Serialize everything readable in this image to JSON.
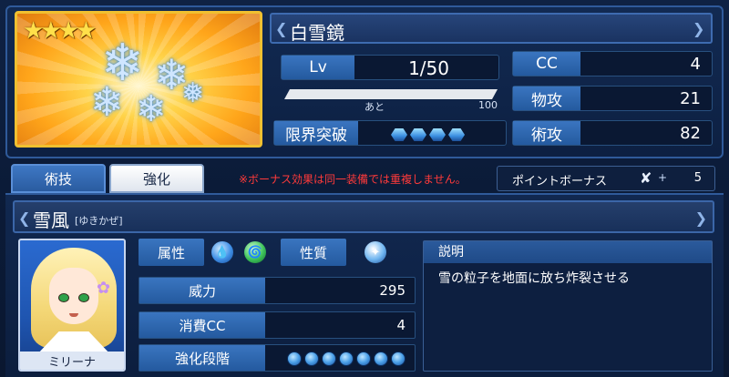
{
  "equipment": {
    "name": "白雪鏡",
    "rarity_stars": "★★★★",
    "level_label": "Lv",
    "level_value": "1/50",
    "xp_remaining_label": "あと",
    "xp_max": "100",
    "limit_break_label": "限界突破",
    "limit_break_level": 0,
    "stats": [
      {
        "label": "CC",
        "value": "4"
      },
      {
        "label": "物攻",
        "value": "21"
      },
      {
        "label": "術攻",
        "value": "82"
      }
    ]
  },
  "tabs": [
    {
      "label": "術技",
      "active": true
    },
    {
      "label": "強化",
      "active": false
    }
  ],
  "notice": "※ボーナス効果は同一装備では重複しません。",
  "point_bonus": {
    "label": "ポイントボーナス",
    "plus": "+",
    "value": "5"
  },
  "skill": {
    "name": "雪風",
    "reading": "[ゆきかぜ]",
    "character_name": "ミリーナ",
    "attribute_label": "属性",
    "property_label": "性質",
    "power_label": "威力",
    "power_value": "295",
    "cost_label": "消費CC",
    "cost_value": "4",
    "enhance_label": "強化段階",
    "enhance_level": 0,
    "desc_label": "説明",
    "desc_text": "雪の粒子を地面に放ち炸裂させる"
  },
  "colors": {
    "accent_blue": "#3a75c0",
    "notice_red": "#ff3a3a",
    "frame_gold": "#f0c030"
  }
}
